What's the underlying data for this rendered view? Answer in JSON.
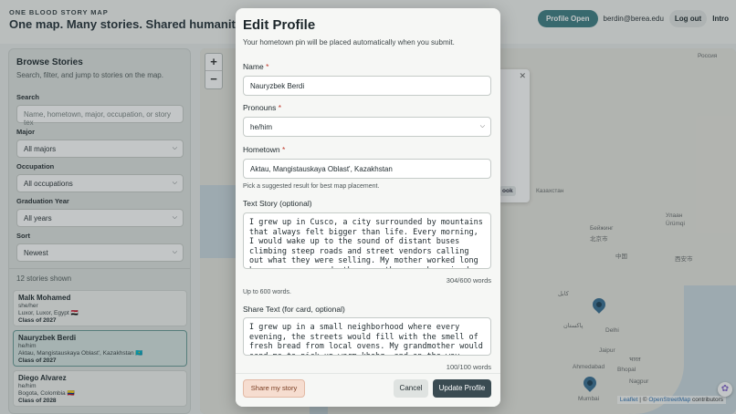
{
  "header": {
    "brand_small": "ONE BLOOD STORY MAP",
    "tagline": "One map. Many stories. Shared humanity.",
    "profile_button": "Profile Open",
    "email": "berdin@berea.edu",
    "logout": "Log out",
    "intro": "Intro"
  },
  "sidebar": {
    "title": "Browse Stories",
    "subtitle": "Search, filter, and jump to stories on the map.",
    "search_label": "Search",
    "search_placeholder": "Name, hometown, major, occupation, or story tex",
    "major_label": "Major",
    "major_value": "All majors",
    "occupation_label": "Occupation",
    "occupation_value": "All occupations",
    "grad_label": "Graduation Year",
    "grad_value": "All years",
    "sort_label": "Sort",
    "sort_value": "Newest",
    "count": "12 stories shown",
    "stories": [
      {
        "name": "Malk Mohamed",
        "pronouns": "she/her",
        "hometown": "Luxor, Luxor, Egypt 🇪🇬",
        "class": "Class of 2027"
      },
      {
        "name": "Nauryzbek Berdi",
        "pronouns": "he/him",
        "hometown": "Aktau, Mangistauskaya Oblast', Kazakhstan 🇰🇿",
        "class": "Class of 2027"
      },
      {
        "name": "Diego Alvarez",
        "pronouns": "he/him",
        "hometown": "Bogota, Colombia 🇨🇴",
        "class": "Class of 2028"
      }
    ]
  },
  "map": {
    "zoom_in": "+",
    "zoom_out": "−",
    "popup_button": "ook",
    "labels": {
      "russia": "Россия",
      "kazakhstan": "Казахстан",
      "beijing": "Бейжинг",
      "beijing_cn": "北京市",
      "china_cn": "中国",
      "delhi": "Delhi",
      "pakistan": "پاکستان",
      "jaipur": "Jaipur",
      "india": "भारत",
      "ahmedabad": "Ahmedabad",
      "bhopal": "Bhopal",
      "mumbai": "Mumbai",
      "nagpur": "Nagpur",
      "ulaan": "Улаан",
      "urumqi": "Ürümqi",
      "xian": "西安市",
      "kabul": "كابل"
    },
    "attribution_leaflet": "Leaflet",
    "attribution_sep": " | © ",
    "attribution_osm": "OpenStreetMap",
    "attribution_tail": " contributors"
  },
  "modal": {
    "title": "Edit Profile",
    "subtitle": "Your hometown pin will be placed automatically when you submit.",
    "name_label": "Name",
    "name_value": "Nauryzbek Berdi",
    "pronouns_label": "Pronouns",
    "pronouns_value": "he/him",
    "hometown_label": "Hometown",
    "hometown_value": "Aktau, Mangistauskaya Oblast', Kazakhstan",
    "hometown_hint": "Pick a suggested result for best map placement.",
    "story_label": "Text Story (optional)",
    "story_value": "I grew up in Cusco, a city surrounded by mountains\nthat always felt bigger than life. Every morning,\nI would wake up to the sound of distant buses\nclimbing steep roads and street vendors calling\nout what they were selling. My mother worked long\nhours, so my grandmother was the one who raised me",
    "story_count": "304/600 words",
    "story_hint": "Up to 600 words.",
    "share_label": "Share Text (for card, optional)",
    "share_value": "I grew up in a small neighborhood where every\nevening, the streets would fill with the smell of\nfresh bread from local ovens. My grandmother would\nsend me to pick up warm khobz, and on the way",
    "share_count": "100/100 words",
    "share_button": "Share my story",
    "cancel_button": "Cancel",
    "update_button": "Update Profile"
  },
  "colors": {
    "accent": "#3f7e84",
    "primary_button": "#3a4b52",
    "required": "#c0392b",
    "pin": "#3a6f93"
  }
}
